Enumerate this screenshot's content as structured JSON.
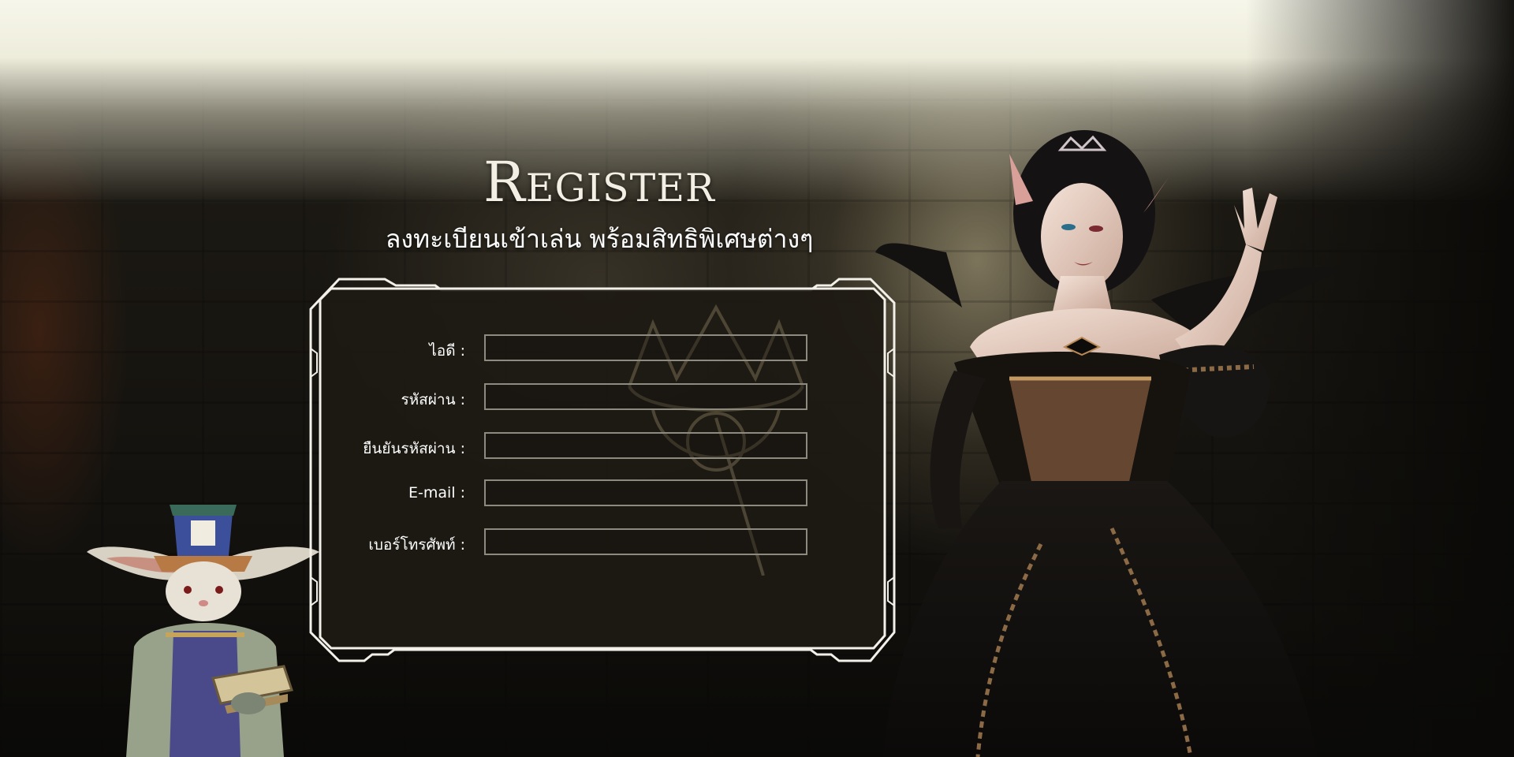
{
  "header": {
    "title": "Register",
    "subtitle": "ลงทะเบียนเข้าเล่น พร้อมสิทธิพิเศษต่างๆ"
  },
  "form": {
    "fields": [
      {
        "label": "ไอดี :",
        "value": ""
      },
      {
        "label": "รหัสผ่าน :",
        "value": ""
      },
      {
        "label": "ยืนยันรหัสผ่าน :",
        "value": ""
      },
      {
        "label": "E-mail :",
        "value": ""
      },
      {
        "label": "เบอร์โทรศัพท์ :",
        "value": ""
      }
    ]
  },
  "colors": {
    "frame_border": "#f2f0e8",
    "panel_bg": "#1d1a14",
    "input_border": "#8d8a80"
  },
  "icons": [
    "crown-emblem-icon",
    "rabbit-mascot-character",
    "elf-sorceress-character"
  ]
}
